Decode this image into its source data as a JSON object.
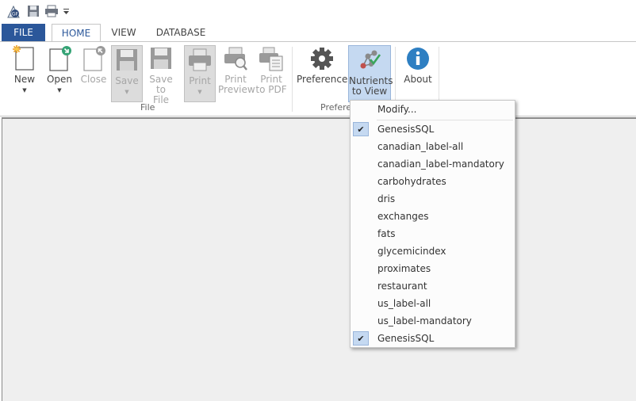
{
  "qat": {
    "icons": [
      "app-logo-icon",
      "save-icon",
      "print-icon",
      "customize-dropdown-icon"
    ]
  },
  "tabs": {
    "file": "FILE",
    "home": "HOME",
    "view": "VIEW",
    "database": "DATABASE"
  },
  "ribbon": {
    "file_group": {
      "label": "File",
      "new": "New",
      "open": "Open",
      "close": "Close",
      "save": "Save",
      "save_to_file_line1": "Save to",
      "save_to_file_line2": "File",
      "print": "Print",
      "print_preview_line1": "Print",
      "print_preview_line2": "Preview",
      "print_pdf_line1": "Print",
      "print_pdf_line2": "to PDF"
    },
    "pref_group": {
      "label": "Prefere",
      "preferences": "Preferences",
      "nutrients_line1": "Nutrients",
      "nutrients_line2": "to View",
      "about": "About"
    }
  },
  "menu": {
    "modify": "Modify...",
    "items": [
      {
        "label": "GenesisSQL",
        "checked": true
      },
      {
        "label": "canadian_label-all",
        "checked": false
      },
      {
        "label": "canadian_label-mandatory",
        "checked": false
      },
      {
        "label": "carbohydrates",
        "checked": false
      },
      {
        "label": "dris",
        "checked": false
      },
      {
        "label": "exchanges",
        "checked": false
      },
      {
        "label": "fats",
        "checked": false
      },
      {
        "label": "glycemicindex",
        "checked": false
      },
      {
        "label": "proximates",
        "checked": false
      },
      {
        "label": "restaurant",
        "checked": false
      },
      {
        "label": "us_label-all",
        "checked": false
      },
      {
        "label": "us_label-mandatory",
        "checked": false
      },
      {
        "label": "GenesisSQL",
        "checked": true
      }
    ],
    "check_glyph": "✔"
  },
  "colors": {
    "accent": "#2b579a",
    "highlight": "#c5d9f1",
    "content_bg": "#efefef"
  }
}
